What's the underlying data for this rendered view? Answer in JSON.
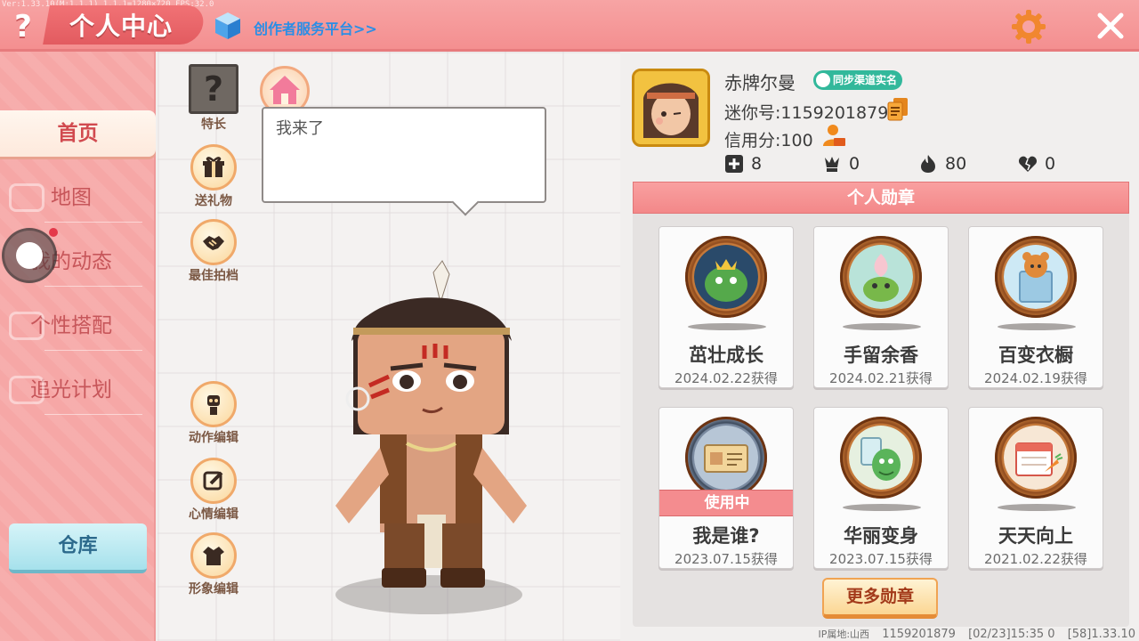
{
  "topbar": {
    "version": "Ver:1.33.10(M:1.1.1) 1.1.1=1280×720 FPS:32.0",
    "help_symbol": "?",
    "title": "个人中心",
    "creator_link": "创作者服务平台>>"
  },
  "colors": {
    "topbar": "#f48f90",
    "nav": "#f6a7a6",
    "accent_text": "#d14a4f",
    "badge_green": "#32b89b",
    "medal_brown": "#c5793a"
  },
  "nav": {
    "items": [
      {
        "label": "首页",
        "active": true
      },
      {
        "label": "地图",
        "active": false
      },
      {
        "label": "我的动态",
        "active": false
      },
      {
        "label": "个性搭配",
        "active": false
      },
      {
        "label": "追光计划",
        "active": false
      }
    ],
    "warehouse": "仓库"
  },
  "center": {
    "specialty_symbol": "?",
    "specialty_label": "特长",
    "gift_label": "送礼物",
    "best_archive_label": "最佳拍档",
    "speech": "我来了",
    "action_edit_label": "动作编辑",
    "mood_edit_label": "心情编辑",
    "image_edit_label": "形象编辑"
  },
  "profile": {
    "name": "赤牌尔曼",
    "badge": "同步渠道实名",
    "mini_id": "迷你号:1159201879",
    "credit": "信用分:100",
    "stats": [
      {
        "icon": "plus-box-icon",
        "value": "8"
      },
      {
        "icon": "trophy-person-icon",
        "value": "0"
      },
      {
        "icon": "fire-icon",
        "value": "80"
      },
      {
        "icon": "broken-heart-icon",
        "value": "0"
      }
    ]
  },
  "medals": {
    "header": "个人勋章",
    "in_use_label": "使用中",
    "more_button": "更多勋章",
    "items": [
      {
        "name": "茁壮成长",
        "date": "2024.02.22获得",
        "in_use": false,
        "icon": "green-dragon-king-icon"
      },
      {
        "name": "手留余香",
        "date": "2024.02.21获得",
        "in_use": false,
        "icon": "lotus-frog-icon"
      },
      {
        "name": "百变衣橱",
        "date": "2024.02.19获得",
        "in_use": false,
        "icon": "bear-wardrobe-icon"
      },
      {
        "name": "我是谁?",
        "date": "2023.07.15获得",
        "in_use": true,
        "icon": "id-card-icon"
      },
      {
        "name": "华丽变身",
        "date": "2023.07.15获得",
        "in_use": false,
        "icon": "dino-mirror-icon"
      },
      {
        "name": "天天向上",
        "date": "2021.02.22获得",
        "in_use": false,
        "icon": "calendar-carrot-icon"
      }
    ]
  },
  "footer": {
    "ip": "IP属地:山西",
    "uid": "1159201879",
    "time": "[02/23]15:35 0",
    "ver": "[58]1.33.10"
  }
}
